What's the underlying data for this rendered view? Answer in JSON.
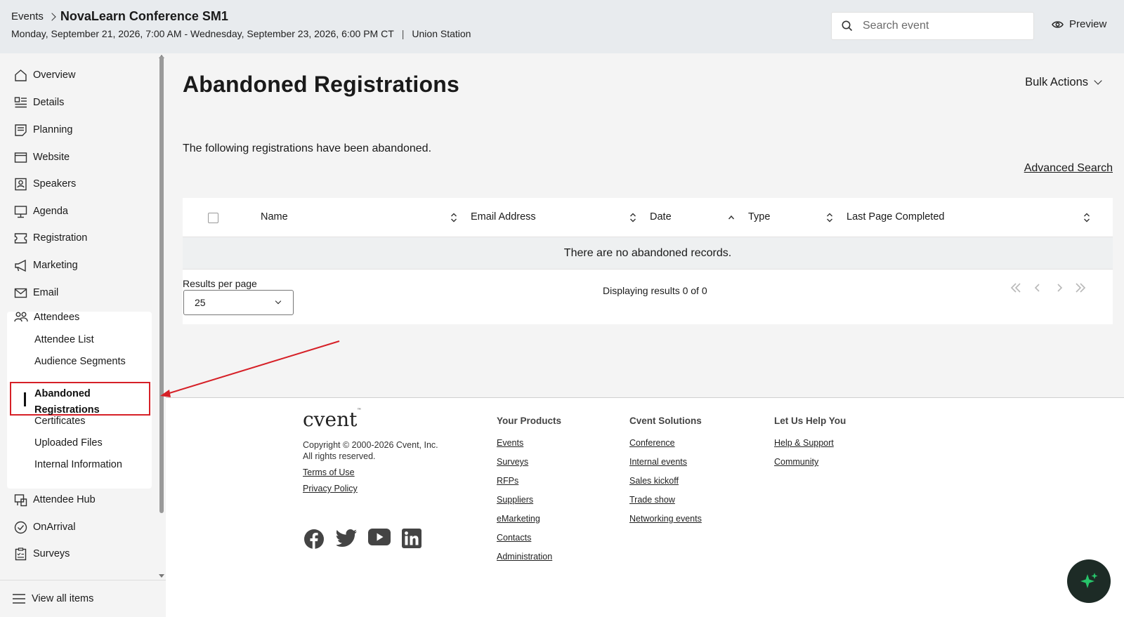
{
  "header": {
    "breadcrumb_root": "Events",
    "event_title": "NovaLearn Conference SM1",
    "date_range": "Monday, September 21, 2026, 7:00 AM - Wednesday, September 23, 2026, 6:00 PM CT",
    "location": "Union Station",
    "search_placeholder": "Search event",
    "preview_label": "Preview"
  },
  "sidebar": {
    "items": [
      {
        "label": "Overview",
        "icon": "home-icon"
      },
      {
        "label": "Details",
        "icon": "details-icon"
      },
      {
        "label": "Planning",
        "icon": "planning-icon"
      },
      {
        "label": "Website",
        "icon": "website-icon"
      },
      {
        "label": "Speakers",
        "icon": "speakers-icon"
      },
      {
        "label": "Agenda",
        "icon": "agenda-icon"
      },
      {
        "label": "Registration",
        "icon": "registration-icon"
      },
      {
        "label": "Marketing",
        "icon": "megaphone-icon"
      },
      {
        "label": "Email",
        "icon": "mail-icon"
      }
    ],
    "attendees": {
      "label": "Attendees",
      "children": [
        "Attendee List",
        "Audience Segments",
        "Abandoned Registrations",
        "Certificates",
        "Uploaded Files",
        "Internal Information"
      ],
      "active_line1": "Abandoned",
      "active_line2": "Registrations"
    },
    "items_after": [
      {
        "label": "Attendee Hub",
        "icon": "hub-icon"
      },
      {
        "label": "OnArrival",
        "icon": "check-circle-icon"
      },
      {
        "label": "Surveys",
        "icon": "survey-icon"
      }
    ],
    "view_all": "View all items"
  },
  "main": {
    "title": "Abandoned Registrations",
    "bulk_actions": "Bulk Actions",
    "description": "The following registrations have been abandoned.",
    "advanced_search": "Advanced Search",
    "columns": [
      "Name",
      "Email Address",
      "Date",
      "Type",
      "Last Page Completed"
    ],
    "empty_message": "There are no abandoned records.",
    "results_per_page_label": "Results per page",
    "results_per_page_value": "25",
    "displaying": "Displaying results 0 of 0"
  },
  "footer": {
    "logo": "cvent",
    "copyright_line1": "Copyright © 2000-2026 Cvent, Inc.",
    "copyright_line2": "All rights reserved.",
    "terms": "Terms of Use",
    "privacy": "Privacy Policy",
    "col1_title": "Your Products",
    "col1_links": [
      "Events",
      "Surveys",
      "RFPs",
      "Suppliers",
      "eMarketing",
      "Contacts",
      "Administration"
    ],
    "col2_title": "Cvent Solutions",
    "col2_links": [
      "Conference",
      "Internal events",
      "Sales kickoff",
      "Trade show",
      "Networking events"
    ],
    "col3_title": "Let Us Help You",
    "col3_links": [
      "Help & Support",
      "Community"
    ],
    "social": [
      "facebook-icon",
      "twitter-icon",
      "youtube-icon",
      "linkedin-icon"
    ]
  },
  "colors": {
    "highlight": "#d62027",
    "ai_button": "#1d2b26",
    "ai_sparkle": "#27c46a"
  }
}
